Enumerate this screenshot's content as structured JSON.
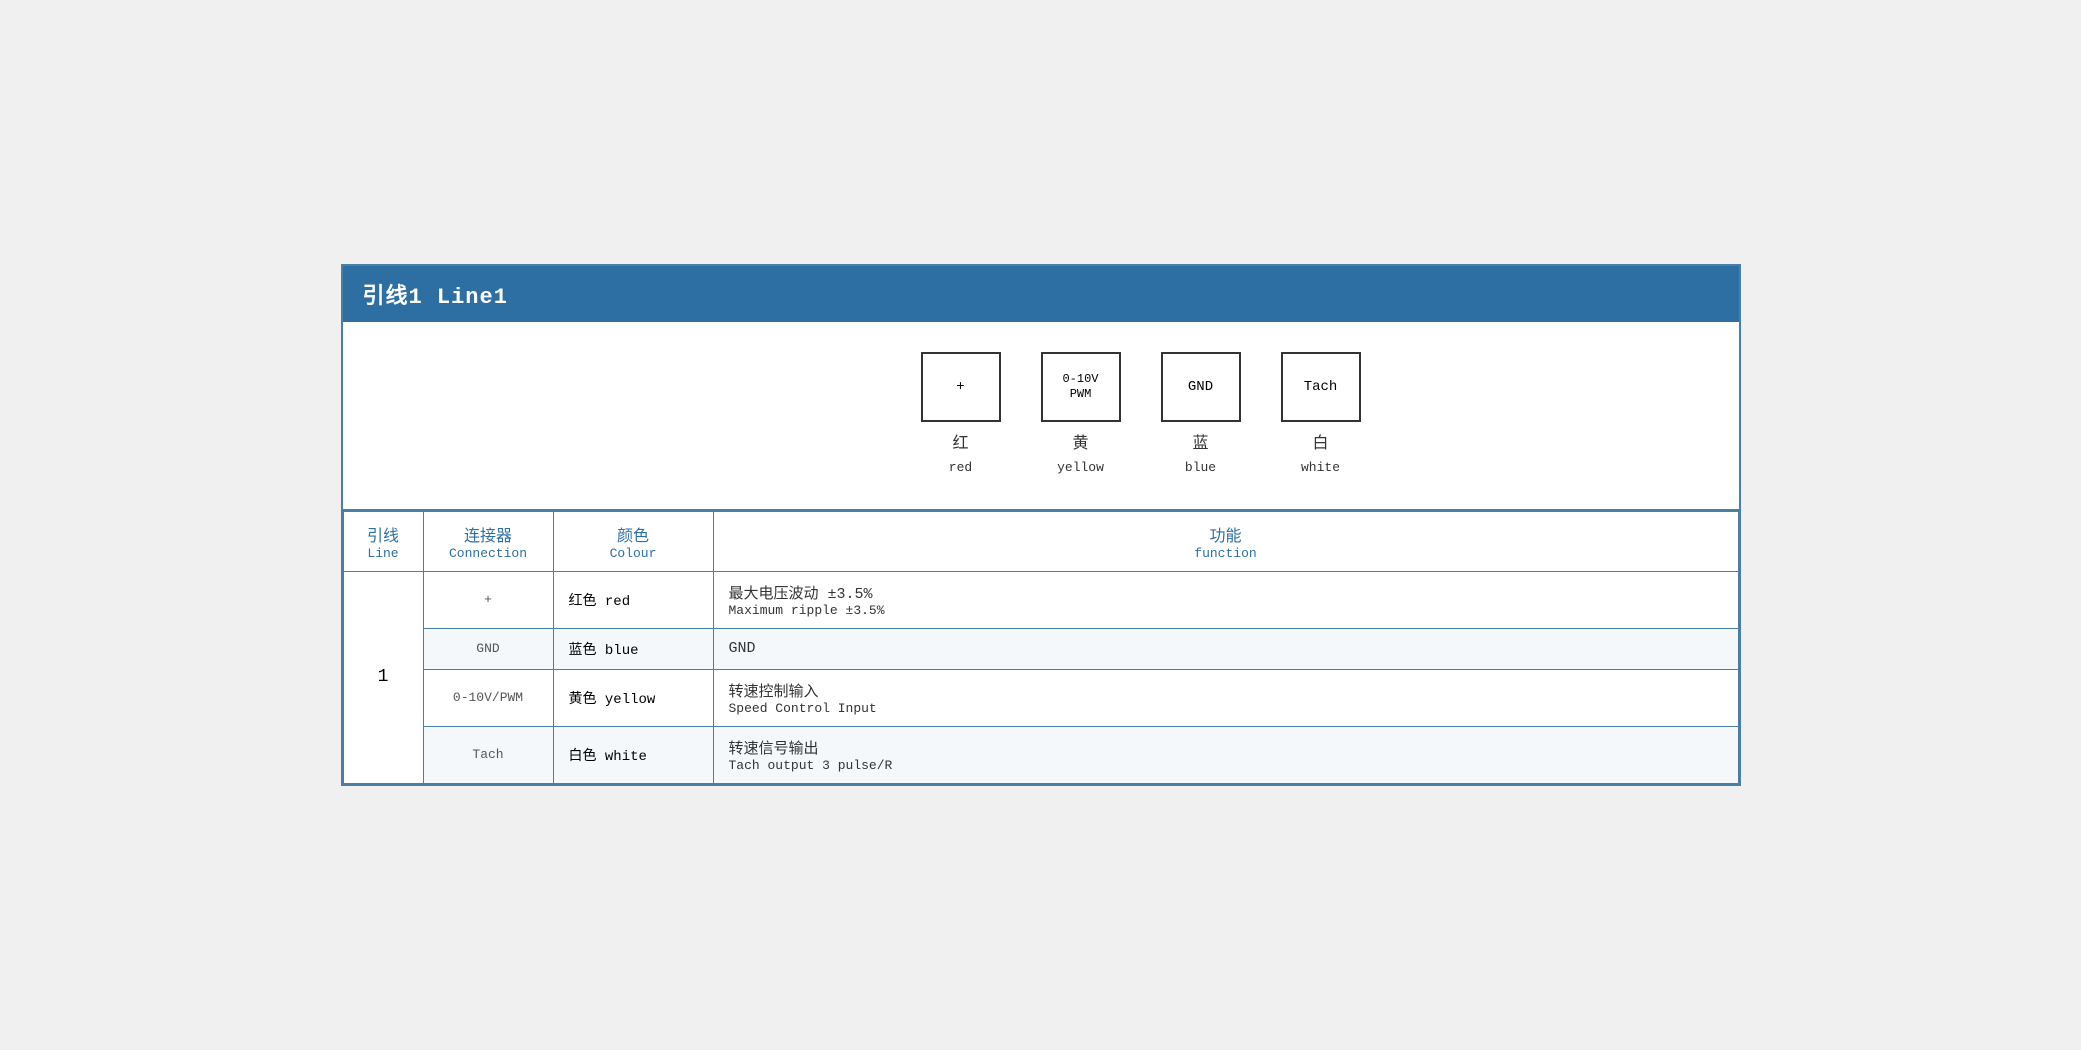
{
  "header": {
    "title": "引线1 Line1"
  },
  "diagram": {
    "connectors": [
      {
        "id": "plus",
        "symbol": "+",
        "label_zh": "红",
        "label_en": "red"
      },
      {
        "id": "pwm",
        "symbol": "0-10V\nPWM",
        "label_zh": "黄",
        "label_en": "yellow"
      },
      {
        "id": "gnd",
        "symbol": "GND",
        "label_zh": "蓝",
        "label_en": "blue"
      },
      {
        "id": "tach",
        "symbol": "Tach",
        "label_zh": "白",
        "label_en": "white"
      }
    ]
  },
  "table": {
    "headers": {
      "line_zh": "引线",
      "line_en": "Line",
      "connection_zh": "连接器",
      "connection_en": "Connection",
      "colour_zh": "颜色",
      "colour_en": "Colour",
      "function_zh": "功能",
      "function_en": "function"
    },
    "rows": [
      {
        "line": "1",
        "connection": "+",
        "colour_zh": "红色 red",
        "function_zh": "最大电压波动 ±3.5%",
        "function_en": "Maximum ripple ±3.5%"
      },
      {
        "line": "",
        "connection": "GND",
        "colour_zh": "蓝色 blue",
        "function_zh": "GND",
        "function_en": ""
      },
      {
        "line": "",
        "connection": "0-10V/PWM",
        "colour_zh": "黄色 yellow",
        "function_zh": "转速控制输入",
        "function_en": "Speed Control Input"
      },
      {
        "line": "",
        "connection": "Tach",
        "colour_zh": "白色 white",
        "function_zh": "转速信号输出",
        "function_en": "Tach output 3 pulse/R"
      }
    ]
  }
}
